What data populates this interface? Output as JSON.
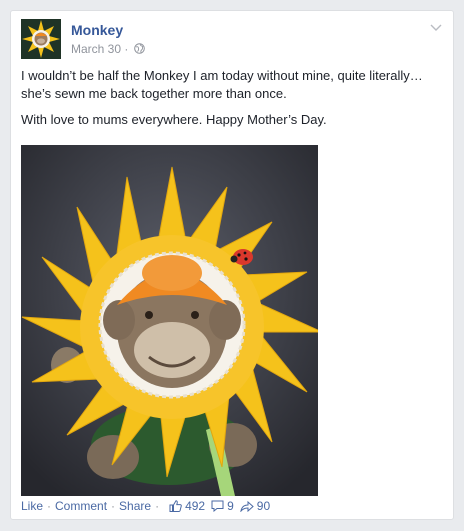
{
  "post": {
    "page_name": "Monkey",
    "date": "March 30",
    "dot": "·",
    "paragraphs": [
      "I wouldn’t be half the Monkey I am today without mine, quite literally… she’s sewn me back together more than once.",
      "With love to mums everywhere. Happy Mother’s Day."
    ],
    "photo_icon": "photo-sunflower-monkey",
    "audience_icon": "globe-icon"
  },
  "actions": {
    "like": "Like",
    "comment": "Comment",
    "share": "Share",
    "separator": "·"
  },
  "stats": {
    "likes": "492",
    "comments": "9",
    "shares": "90"
  },
  "colors": {
    "link": "#365899",
    "muted": "#90949c",
    "background": "#e9ebee",
    "petal": "#f5c21b"
  }
}
